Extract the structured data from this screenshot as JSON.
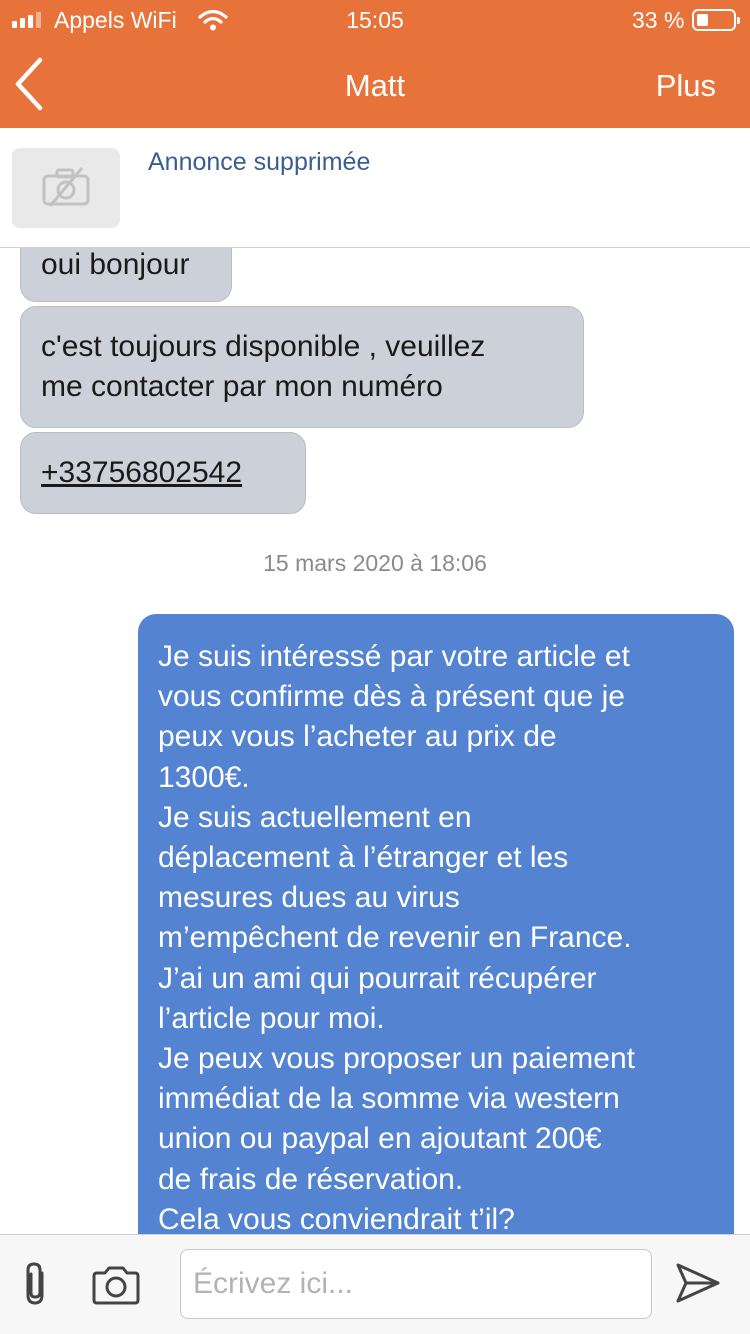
{
  "status_bar": {
    "carrier": "Appels WiFi",
    "time": "15:05",
    "battery": "33 %",
    "battery_level": 0.33,
    "icons": [
      "signal-icon",
      "wifi-icon",
      "battery-icon"
    ]
  },
  "header": {
    "title": "Matt",
    "more_label": "Plus",
    "back_icon": "chevron-left-icon"
  },
  "ad": {
    "title": "Annonce supprimée",
    "thumb_icon": "no-camera-icon"
  },
  "messages": {
    "incoming": [
      {
        "text": "oui bonjour"
      },
      {
        "text": "c'est toujours disponible , veuillez",
        "text2": "me contacter par mon numéro"
      },
      {
        "text": "+33756802542"
      }
    ],
    "timestamp": "15 mars 2020 à 18:06",
    "outgoing_lines": [
      "Je suis intéressé par votre article et",
      "vous confirme dès à présent que je",
      "peux vous l’acheter au prix de",
      "1300€.",
      "Je suis actuellement en",
      "déplacement à l’étranger et les",
      "mesures dues au virus",
      "m’empêchent de revenir en France.",
      "J’ai un ami qui pourrait récupérer",
      "l’article pour moi.",
      "Je peux vous proposer un paiement",
      "immédiat de la somme via western",
      "union ou paypal en ajoutant 200€",
      "de frais de réservation.",
      "Cela vous conviendrait t’il?"
    ]
  },
  "composer": {
    "placeholder": "Écrivez ici...",
    "icons": [
      "paperclip-icon",
      "camera-icon",
      "send-icon"
    ]
  },
  "colors": {
    "header": "#e8733a",
    "incoming_bubble": "#ccd0d8",
    "outgoing_bubble": "#5383d1",
    "ad_title": "#3a5f8f"
  }
}
